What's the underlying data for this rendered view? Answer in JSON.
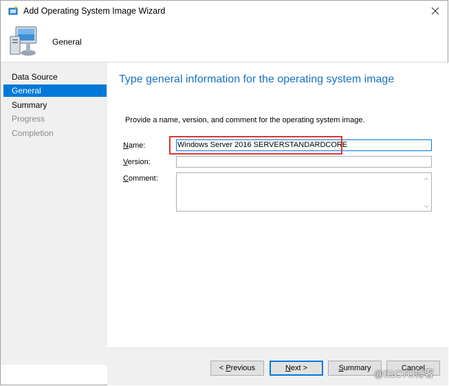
{
  "window": {
    "title": "Add Operating System Image Wizard"
  },
  "header": {
    "title": "General"
  },
  "sidebar": {
    "items": [
      {
        "label": "Data Source",
        "state": "normal"
      },
      {
        "label": "General",
        "state": "selected"
      },
      {
        "label": "Summary",
        "state": "normal"
      },
      {
        "label": "Progress",
        "state": "disabled"
      },
      {
        "label": "Completion",
        "state": "disabled"
      }
    ]
  },
  "main": {
    "heading": "Type general information for the operating system image",
    "instruction": "Provide a name, version, and comment for the operating system image.",
    "name_label_key": "N",
    "name_label_rest": "ame:",
    "name_value": "Windows Server 2016 SERVERSTANDARDCORE",
    "version_label_key": "V",
    "version_label_rest": "ersion:",
    "version_value": "",
    "comment_label_key": "C",
    "comment_label_rest": "omment:",
    "comment_value": ""
  },
  "footer": {
    "previous_prefix": "< ",
    "previous_key": "P",
    "previous_rest": "revious",
    "next_key": "N",
    "next_rest": "ext >",
    "summary_key": "S",
    "summary_rest": "ummary",
    "cancel_label": "Cancel"
  },
  "watermark": "@51CTO博客",
  "colors": {
    "accent": "#0078d7",
    "heading": "#1a70c0",
    "highlight": "#e03434"
  },
  "icons": {
    "title": "wizard-icon",
    "header": "computer-monitor-icon",
    "close": "close-icon"
  }
}
